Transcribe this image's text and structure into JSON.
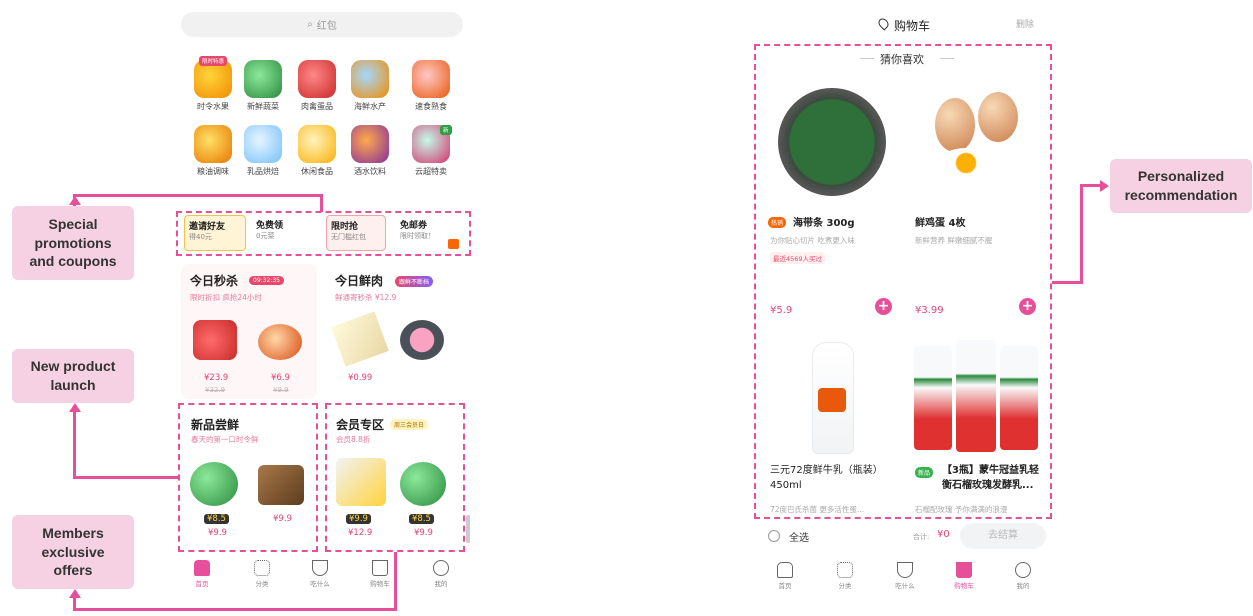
{
  "left": {
    "search_placeholder": "红包",
    "categories": [
      {
        "label": "时令水果",
        "badge": "限时特惠"
      },
      {
        "label": "新鲜蔬菜"
      },
      {
        "label": "肉禽蛋品"
      },
      {
        "label": "海鲜水产"
      },
      {
        "label": "速食熟食"
      },
      {
        "label": "粮油调味"
      },
      {
        "label": "乳品烘焙"
      },
      {
        "label": "休闲食品"
      },
      {
        "label": "酒水饮料"
      },
      {
        "label": "云超特卖",
        "badge": "新"
      }
    ],
    "promos": [
      {
        "title": "邀请好友",
        "sub": "得40元"
      },
      {
        "title": "免费领",
        "sub": "0元菜"
      },
      {
        "title": "限时抢",
        "sub": "无门槛红包"
      },
      {
        "title": "免邮券",
        "sub": "限时领取！"
      }
    ],
    "seckill": {
      "title": "今日秒杀",
      "timer": "09:32:35",
      "sub": "限时折扣 疯抢24小时",
      "items": [
        {
          "price": "¥23.9",
          "orig": "¥32.9"
        },
        {
          "price": "¥6.9",
          "orig": "¥9.9"
        }
      ]
    },
    "fresh": {
      "title": "今日鲜肉",
      "badge": "跟鲜不断档",
      "sub": "鲜通寄秒杀 ¥12.9",
      "items": [
        {
          "price": "¥0.99"
        }
      ]
    },
    "new_products": {
      "title": "新品尝鲜",
      "sub": "春天的第一口时令鲜",
      "items": [
        {
          "member_price": "¥8.5",
          "price": "¥9.9"
        },
        {
          "price": "¥9.9"
        }
      ]
    },
    "members": {
      "title": "会员专区",
      "badge": "周三会员日",
      "sub": "会员8.8折",
      "items": [
        {
          "member_price": "¥9.9",
          "price": "¥12.9"
        },
        {
          "member_price": "¥8.5",
          "price": "¥9.9"
        }
      ]
    },
    "nav": [
      "首页",
      "分类",
      "吃什么",
      "购物车",
      "我的"
    ]
  },
  "right": {
    "header_title": "购物车",
    "header_action": "删除",
    "section_title": "猜你喜欢",
    "products": [
      {
        "tag": "热销",
        "name": "海带条 300g",
        "desc": "为你贴心切片 吃煮更入味",
        "note": "最近4569人买过",
        "price": "¥5.9"
      },
      {
        "name": "鲜鸡蛋 4枚",
        "desc": "新鲜营养 鲜嫩细腻不腥",
        "price": "¥3.99"
      },
      {
        "name": "三元72度鲜牛乳（瓶装）450ml",
        "desc": "72度巴氏杀菌 更多活性蛋..."
      },
      {
        "tag": "新品",
        "name": "【3瓶】蒙牛冠益乳轻衡石榴玫瑰发酵乳...",
        "desc": "石榴配玫瑰 予你满满的浪漫"
      }
    ],
    "select_all": "全选",
    "total_label": "合计:",
    "total_value": "¥0",
    "checkout": "去结算",
    "nav": [
      "首页",
      "分类",
      "吃什么",
      "购物车",
      "我的"
    ]
  },
  "callouts": {
    "promotions": "Special promotions and coupons",
    "new_product": "New product launch",
    "members": "Members exclusive offers",
    "personalized": "Personalized recommendation"
  },
  "colors": {
    "accent": "#e64f9a",
    "callout_bg": "#f6d1e3",
    "price": "#e54575"
  }
}
